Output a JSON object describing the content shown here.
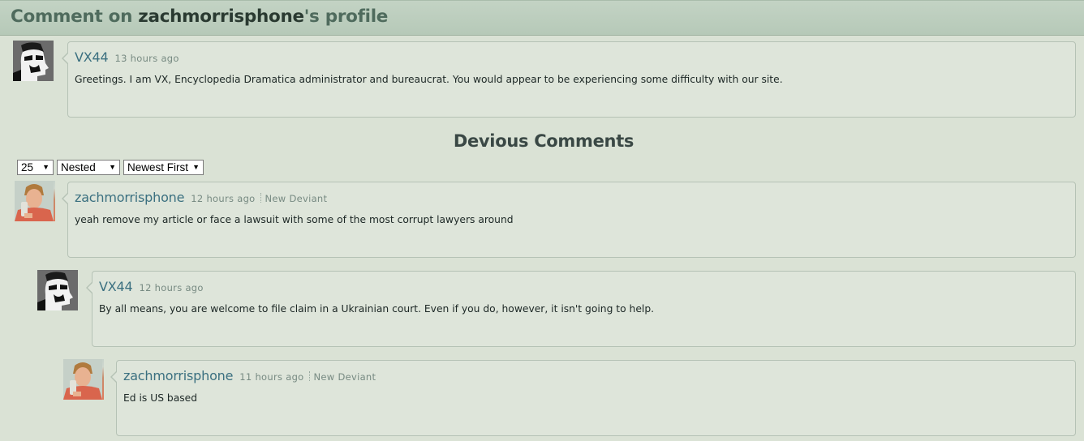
{
  "header": {
    "prefix": "Comment on ",
    "username": "zachmorrisphone",
    "suffix": "'s profile"
  },
  "main_comment": {
    "author": "VX44",
    "time": "13 hours ago",
    "text": "Greetings. I am VX, Encyclopedia Dramatica administrator and bureaucrat. You would appear to be experiencing some difficulty with our site."
  },
  "section_title": "Devious Comments",
  "controls": {
    "per_page": "25",
    "view_mode": "Nested",
    "sort_order": "Newest First",
    "dropdown_icon": "triangle-down"
  },
  "comments": [
    {
      "author": "zachmorrisphone",
      "time": "12 hours ago",
      "badge": "New Deviant",
      "text": "yeah remove my article or face a lawsuit with some of the most corrupt lawyers around"
    },
    {
      "author": "VX44",
      "time": "12 hours ago",
      "text": "By all means, you are welcome to file claim in a Ukrainian court. Even if you do, however, it  isn't going to help."
    },
    {
      "author": "zachmorrisphone",
      "time": "11 hours ago",
      "badge": "New Deviant",
      "text": "Ed is US based"
    }
  ],
  "colors": {
    "page_background": "#dae2d5",
    "header_background": "#b8cab9",
    "author_link": "#3b7080",
    "bubble_background": "#dee5da"
  }
}
